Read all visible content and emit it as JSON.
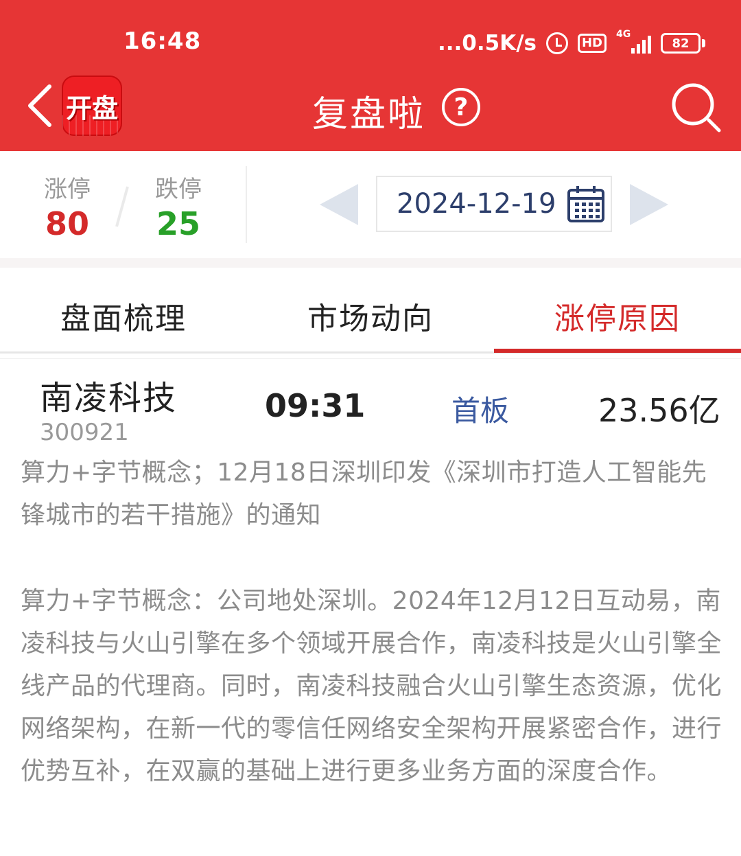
{
  "status_bar": {
    "time": "16:48",
    "net_speed": "...0.5K/s",
    "hd_label": "HD",
    "network_label": "4G",
    "battery": "82"
  },
  "header": {
    "app_name": "开盘",
    "title": "复盘啦",
    "help_symbol": "?"
  },
  "stats": {
    "limit_up_label": "涨停",
    "limit_up_count": "80",
    "limit_down_label": "跌停",
    "limit_down_count": "25"
  },
  "date": {
    "value": "2024-12-19"
  },
  "tabs": [
    {
      "label": "盘面梳理",
      "active": false
    },
    {
      "label": "市场动向",
      "active": false
    },
    {
      "label": "涨停原因",
      "active": true
    }
  ],
  "stock": {
    "name": "南凌科技",
    "code": "300921",
    "limit_time": "09:31",
    "board": "首板",
    "market_cap": "23.56亿"
  },
  "reasons": {
    "summary": "算力+字节概念；12月18日深圳印发《深圳市打造人工智能先锋城市的若干措施》的通知",
    "detail": "算力+字节概念：公司地处深圳。2024年12月12日互动易，南凌科技与火山引擎在多个领域开展合作，南凌科技是火山引擎全线产品的代理商。同时，南凌科技融合火山引擎生态资源，优化网络架构，在新一代的零信任网络安全架构开展紧密合作，进行优势互补，在双赢的基础上进行更多业务方面的深度合作。"
  },
  "colors": {
    "header_bg": "#e63535",
    "limit_up": "#d42a2a",
    "limit_down": "#28a028",
    "active_tab": "#d42a2a",
    "board_tag": "#3b5aa0",
    "date_text": "#2c3e6b"
  },
  "icons": [
    "back-chevron-icon",
    "app-logo",
    "help-icon",
    "search-icon",
    "prev-arrow-icon",
    "calendar-icon",
    "next-arrow-icon",
    "alarm-icon",
    "signal-icon",
    "battery-icon"
  ]
}
